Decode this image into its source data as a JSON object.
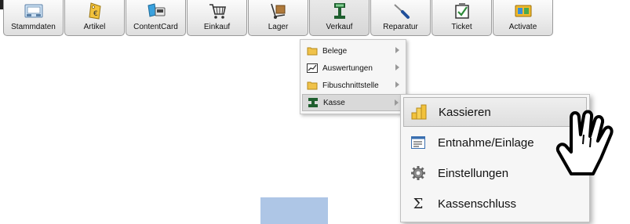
{
  "toolbar": {
    "buttons": [
      {
        "label": "Stammdaten",
        "icon": "id-card-icon"
      },
      {
        "label": "Artikel",
        "icon": "price-tag-icon"
      },
      {
        "label": "ContentCard",
        "icon": "content-card-icon"
      },
      {
        "label": "Einkauf",
        "icon": "shopping-cart-icon"
      },
      {
        "label": "Lager",
        "icon": "hand-truck-icon"
      },
      {
        "label": "Verkauf",
        "icon": "cash-register-icon",
        "active": true
      },
      {
        "label": "Reparatur",
        "icon": "screwdriver-icon"
      },
      {
        "label": "Ticket",
        "icon": "checkbox-icon"
      },
      {
        "label": "Activate",
        "icon": "activate-card-icon"
      }
    ]
  },
  "verkauf_menu": {
    "items": [
      {
        "label": "Belege",
        "icon": "folder-icon"
      },
      {
        "label": "Auswertungen",
        "icon": "chart-icon"
      },
      {
        "label": "Fibuschnittstelle",
        "icon": "folder-icon"
      },
      {
        "label": "Kasse",
        "icon": "cash-register-icon",
        "highlighted": true
      }
    ]
  },
  "kasse_menu": {
    "items": [
      {
        "label": "Kassieren",
        "icon": "coins-icon",
        "highlighted": true
      },
      {
        "label": "Entnahme/Einlage",
        "icon": "list-form-icon"
      },
      {
        "label": "Einstellungen",
        "icon": "gear-icon"
      },
      {
        "label": "Kassenschluss",
        "icon": "sigma-icon"
      }
    ]
  },
  "colors": {
    "folder": "#f0c24a",
    "highlight": "#d9d9d9",
    "blue_block": "#aec6e6"
  }
}
